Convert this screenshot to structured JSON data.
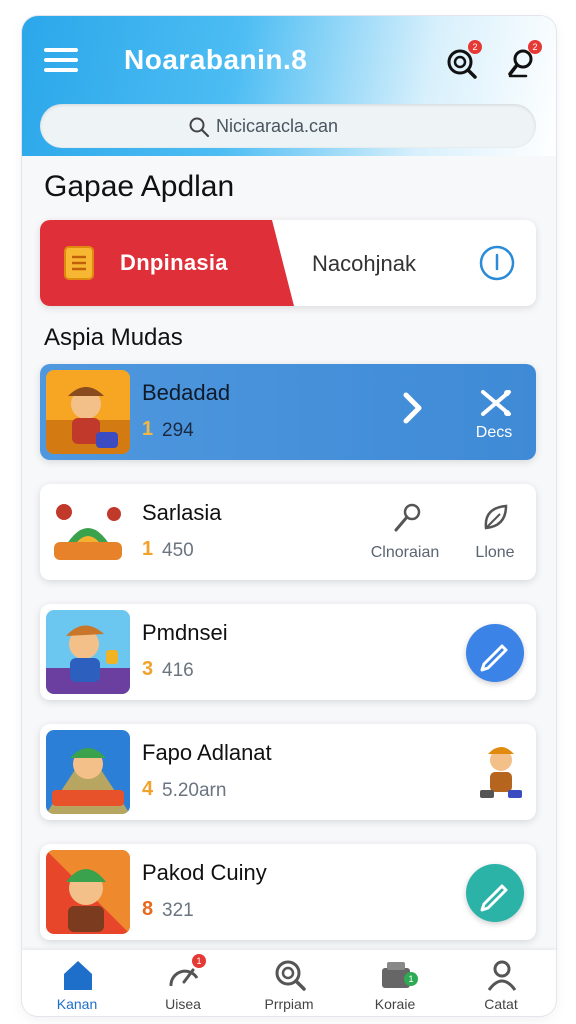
{
  "header": {
    "app_title": "Noarabanin.8",
    "menu_icon": "hamburger-menu-icon",
    "icons": [
      {
        "name": "search-target-icon",
        "badge": "2"
      },
      {
        "name": "notification-icon",
        "badge": "2"
      }
    ]
  },
  "search": {
    "placeholder": "Nicicaracla.can",
    "icon": "search-icon"
  },
  "section": {
    "title": "Gapae Apdlan",
    "subtitle": "Aspia Mudas"
  },
  "tabs": {
    "active_label": "Dnpinasia",
    "inactive_label": "Nacohjnak",
    "active_color": "#df3039"
  },
  "games": [
    {
      "name": "Bedadad",
      "rank": "1",
      "count": "294",
      "highlight": true,
      "actions": [
        {
          "icon": "chevron-right-icon",
          "label": ""
        },
        {
          "icon": "shuffle-icon",
          "label": "Decs"
        }
      ]
    },
    {
      "name": "Sarlasia",
      "rank": "1",
      "count": "450",
      "actions": [
        {
          "icon": "key-icon",
          "label": "Clnoraian"
        },
        {
          "icon": "leaf-icon",
          "label": "Llone"
        }
      ]
    },
    {
      "name": "Pmdnsei",
      "rank": "3",
      "count": "416",
      "fab_color": "#3b83e6"
    },
    {
      "name": "Fapo Adlanat",
      "rank": "4",
      "count": "5.20arn"
    },
    {
      "name": "Pakod Cuiny",
      "rank": "8",
      "count": "321",
      "fab_color": "#2bb3a8"
    }
  ],
  "bottom_nav": [
    {
      "label": "Kanan",
      "icon": "home-icon",
      "active": true
    },
    {
      "label": "Uisea",
      "icon": "gauge-icon",
      "badge": "1"
    },
    {
      "label": "Prrpiam",
      "icon": "search-icon"
    },
    {
      "label": "Koraie",
      "icon": "inbox-icon",
      "badge": "1"
    },
    {
      "label": "Catat",
      "icon": "profile-icon"
    }
  ],
  "colors": {
    "accent": "#2ba7ea",
    "highlight_card": "#4f98df",
    "rank": "#f2a22b",
    "nav_active": "#1e6fc9"
  }
}
